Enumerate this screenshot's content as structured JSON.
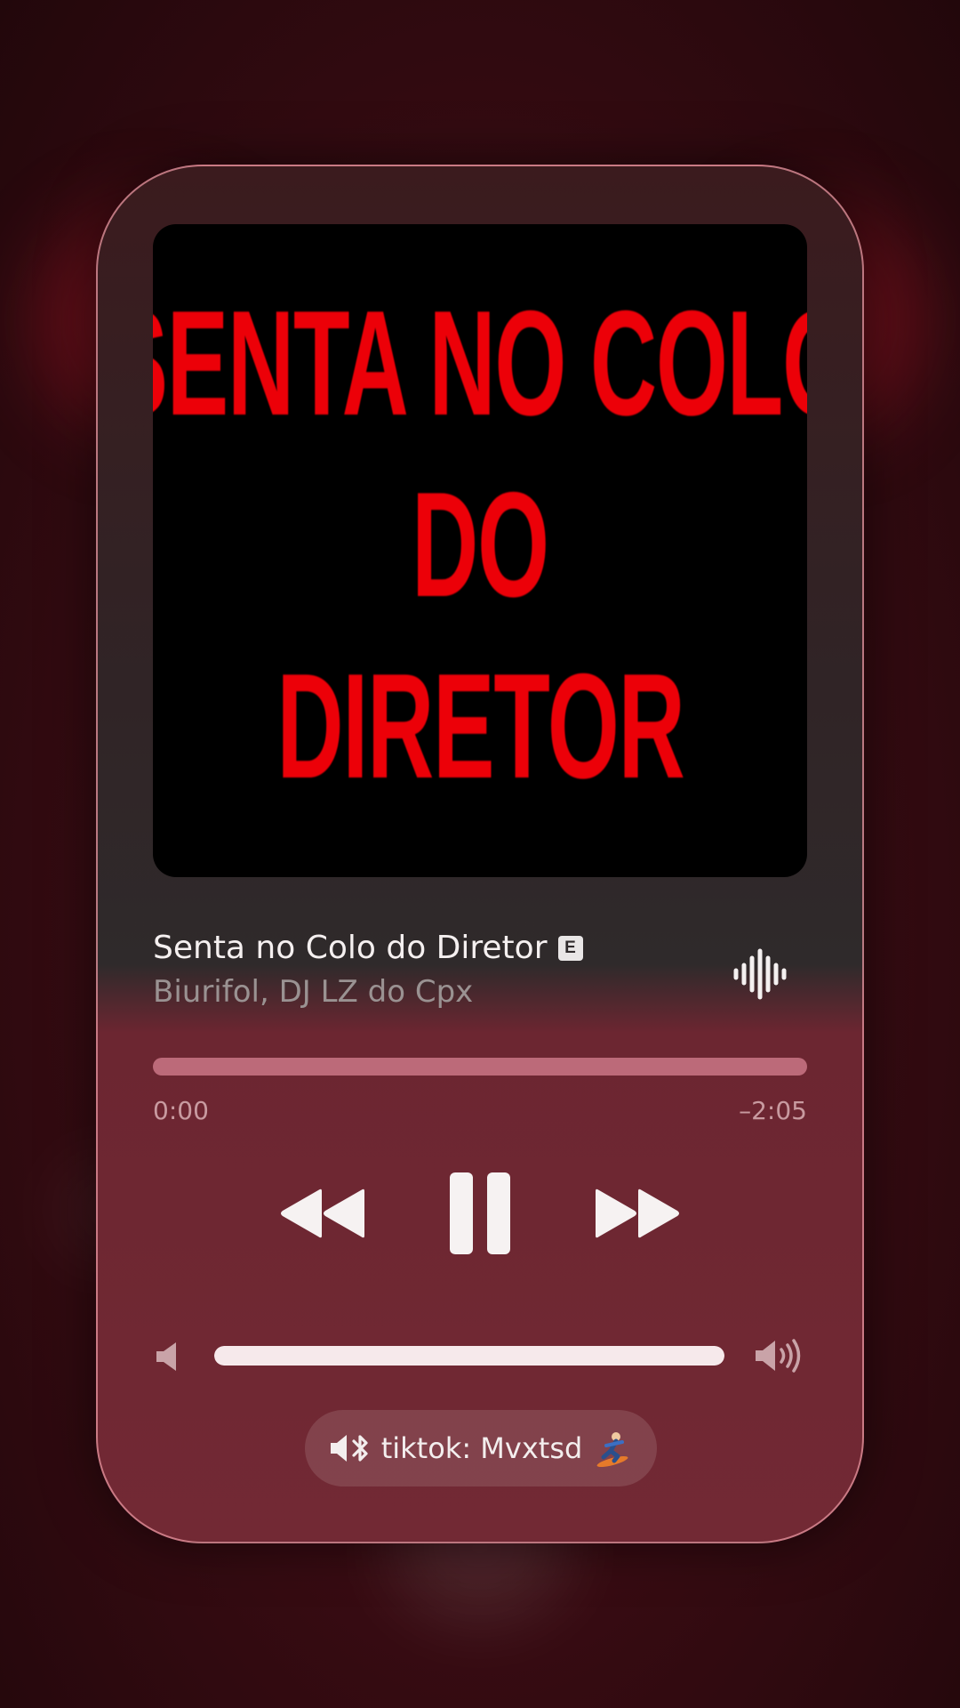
{
  "artwork": {
    "lines": [
      "SENTA NO COLO",
      "DO",
      "DIRETOR"
    ]
  },
  "track": {
    "title": "Senta no Colo do Diretor",
    "explicit_label": "E",
    "artist": "Biurifol, DJ LZ do Cpx"
  },
  "playback": {
    "elapsed": "0:00",
    "remaining": "–2:05",
    "progress_fraction": 0.0,
    "state": "playing"
  },
  "volume": {
    "level_fraction": 1.0
  },
  "output_route": {
    "label": "tiktok: Mvxtsd",
    "icon": "speaker-bluetooth-icon",
    "emoji_icon": "snowboarder-icon"
  },
  "colors": {
    "accent_red": "#ec0008",
    "card_border": "#e896a0",
    "card_bottom": "#722934"
  }
}
